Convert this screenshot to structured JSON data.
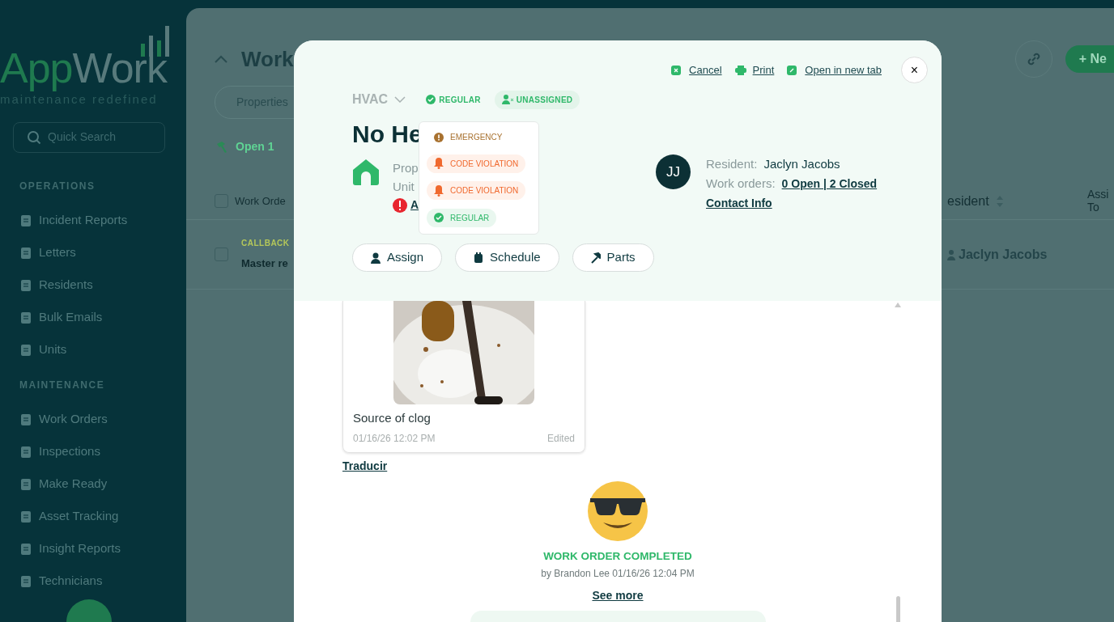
{
  "sidebar": {
    "logo": {
      "first": "App",
      "second": "Work",
      "tagline": "maintenance redefined"
    },
    "search": {
      "placeholder": "Quick Search"
    },
    "sections": [
      {
        "title": "OPERATIONS",
        "items": [
          {
            "label": "Incident Reports"
          },
          {
            "label": "Letters"
          },
          {
            "label": "Residents"
          },
          {
            "label": "Bulk Emails"
          },
          {
            "label": "Units"
          }
        ]
      },
      {
        "title": "MAINTENANCE",
        "items": [
          {
            "label": "Work Orders"
          },
          {
            "label": "Inspections"
          },
          {
            "label": "Make Ready"
          },
          {
            "label": "Asset Tracking"
          },
          {
            "label": "Insight Reports"
          },
          {
            "label": "Technicians"
          }
        ]
      }
    ]
  },
  "page": {
    "title": "Work",
    "filter": "Properties",
    "open_tab": "Open 1",
    "new_button": "+ Ne",
    "table": {
      "select_all_checked": false,
      "columns": [
        "Work Orde",
        "esident",
        "Assi\nTo"
      ],
      "rows": [
        {
          "checked": false,
          "tag": "CALLBACK",
          "title": "Master re",
          "resident": "Jaclyn Jacobs"
        }
      ]
    }
  },
  "modal": {
    "links": [
      {
        "label": "Cancel"
      },
      {
        "label": "Print"
      },
      {
        "label": "Open in new tab"
      }
    ],
    "close": "×",
    "category": "HVAC",
    "badges": [
      {
        "label": "REGULAR",
        "kind": "priority"
      },
      {
        "label": "UNASSIGNED",
        "kind": "assignee"
      }
    ],
    "title": "No He",
    "property_lines": [
      "Prop",
      "Unit"
    ],
    "alert_link": "A",
    "resident": {
      "initials": "JJ",
      "label": "Resident:",
      "name": "Jaclyn Jacobs",
      "orders_label": "Work orders:",
      "orders": "0 Open | 2 Closed",
      "contact": "Contact Info"
    },
    "actions": [
      {
        "label": "Assign"
      },
      {
        "label": "Schedule"
      },
      {
        "label": "Parts"
      }
    ],
    "priority_menu": [
      {
        "label": "EMERGENCY",
        "kind": "emergency",
        "color": "#a8712f"
      },
      {
        "label": "CODE VIOLATION",
        "kind": "violation",
        "color": "#f0692e"
      },
      {
        "label": "CODE VIOLATION",
        "kind": "violation",
        "color": "#f0692e"
      },
      {
        "label": "REGULAR",
        "kind": "regular",
        "color": "#2fb86a"
      }
    ],
    "photo_note": {
      "caption": "Source of clog",
      "time": "01/16/26 12:02 PM",
      "edited": "Edited"
    },
    "translate": "Traducir",
    "event": {
      "title": "WORK ORDER COMPLETED",
      "by": "by Brandon Lee 01/16/26 12:04 PM",
      "more": "See more"
    }
  }
}
